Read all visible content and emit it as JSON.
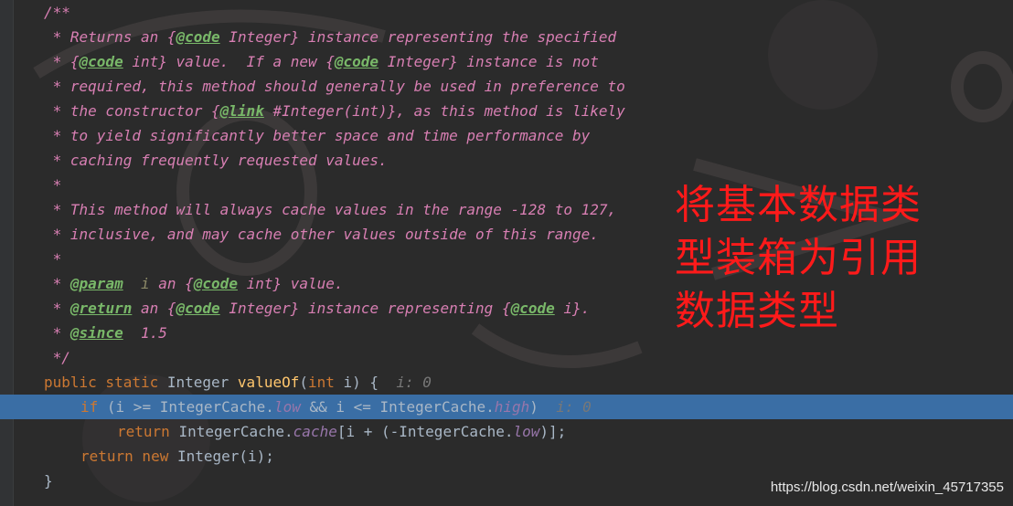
{
  "editor": {
    "lines": [
      [
        {
          "t": "/**",
          "c": "c"
        }
      ],
      [
        {
          "t": " * Returns an {",
          "c": "c"
        },
        {
          "t": "@code",
          "c": "tag"
        },
        {
          "t": " Integer} instance representing the specified",
          "c": "c"
        }
      ],
      [
        {
          "t": " * {",
          "c": "c"
        },
        {
          "t": "@code",
          "c": "tag"
        },
        {
          "t": " int} value.  If a new {",
          "c": "c"
        },
        {
          "t": "@code",
          "c": "tag"
        },
        {
          "t": " Integer} instance is not",
          "c": "c"
        }
      ],
      [
        {
          "t": " * required, this method should generally be used in preference to",
          "c": "c"
        }
      ],
      [
        {
          "t": " * the constructor {",
          "c": "c"
        },
        {
          "t": "@link",
          "c": "tag"
        },
        {
          "t": " #Integer(int)}, as this method is likely",
          "c": "c"
        }
      ],
      [
        {
          "t": " * to yield significantly better space and time performance by",
          "c": "c"
        }
      ],
      [
        {
          "t": " * caching frequently requested values.",
          "c": "c"
        }
      ],
      [
        {
          "t": " *",
          "c": "c"
        }
      ],
      [
        {
          "t": " * This method will always cache values in the range -128 to 127,",
          "c": "c"
        }
      ],
      [
        {
          "t": " * inclusive, and may cache other values outside of this range.",
          "c": "c"
        }
      ],
      [
        {
          "t": " *",
          "c": "c"
        }
      ],
      [
        {
          "t": " * ",
          "c": "c"
        },
        {
          "t": "@param",
          "c": "tagb"
        },
        {
          "t": "  ",
          "c": "c"
        },
        {
          "t": "i",
          "c": "pn"
        },
        {
          "t": " an {",
          "c": "c"
        },
        {
          "t": "@code",
          "c": "tag"
        },
        {
          "t": " int} value.",
          "c": "c"
        }
      ],
      [
        {
          "t": " * ",
          "c": "c"
        },
        {
          "t": "@return",
          "c": "tagb"
        },
        {
          "t": " an {",
          "c": "c"
        },
        {
          "t": "@code",
          "c": "tag"
        },
        {
          "t": " Integer} instance representing {",
          "c": "c"
        },
        {
          "t": "@code",
          "c": "tag"
        },
        {
          "t": " i}.",
          "c": "c"
        }
      ],
      [
        {
          "t": " * ",
          "c": "c"
        },
        {
          "t": "@since",
          "c": "tagb"
        },
        {
          "t": "  1.5",
          "c": "c"
        }
      ],
      [
        {
          "t": " */",
          "c": "c"
        }
      ],
      [
        {
          "t": "public static ",
          "c": "kw"
        },
        {
          "t": "Integer ",
          "c": "ty"
        },
        {
          "t": "valueOf",
          "c": "fn"
        },
        {
          "t": "(",
          "c": "ty"
        },
        {
          "t": "int ",
          "c": "kw"
        },
        {
          "t": "i) {  ",
          "c": "ty"
        },
        {
          "t": "i: 0",
          "c": "hint"
        }
      ],
      [
        {
          "t": "if ",
          "c": "kw"
        },
        {
          "t": "(i >= IntegerCache.",
          "c": "ty"
        },
        {
          "t": "low",
          "c": "fld"
        },
        {
          "t": " && i <= IntegerCache.",
          "c": "ty"
        },
        {
          "t": "high",
          "c": "fld"
        },
        {
          "t": ")  ",
          "c": "ty"
        },
        {
          "t": "i: 0",
          "c": "hint"
        }
      ],
      [
        {
          "t": "return ",
          "c": "kw"
        },
        {
          "t": "IntegerCache.",
          "c": "ty"
        },
        {
          "t": "cache",
          "c": "fld"
        },
        {
          "t": "[i + (-IntegerCache.",
          "c": "ty"
        },
        {
          "t": "low",
          "c": "fld"
        },
        {
          "t": ")];",
          "c": "ty"
        }
      ],
      [
        {
          "t": "return new ",
          "c": "kw"
        },
        {
          "t": "Integer(i);",
          "c": "ty"
        }
      ],
      [
        {
          "t": "}",
          "c": "ty"
        }
      ]
    ],
    "indents": [
      0,
      0,
      0,
      0,
      0,
      0,
      0,
      0,
      0,
      0,
      0,
      0,
      0,
      0,
      0,
      0,
      1,
      2,
      1,
      0
    ],
    "highlighted_line": 16
  },
  "annotation": {
    "line1": "将基本数据类",
    "line2": "型装箱为引用",
    "line3": "数据类型",
    "color": "#ff1a1a"
  },
  "watermark": "https://blog.csdn.net/weixin_45717355"
}
